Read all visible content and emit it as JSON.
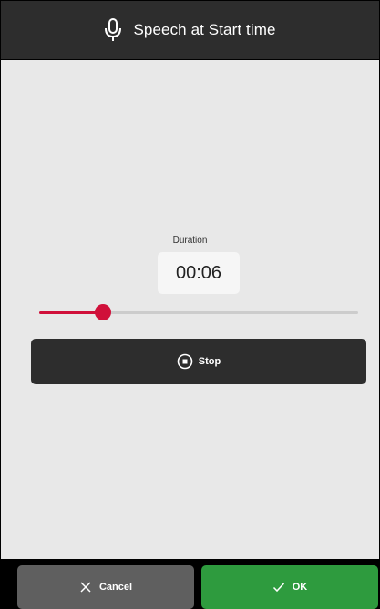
{
  "header": {
    "title": "Speech at Start time",
    "icon": "microphone-icon"
  },
  "duration": {
    "label": "Duration",
    "value": "00:06"
  },
  "slider": {
    "fraction": 0.2
  },
  "actions": {
    "stop_label": "Stop",
    "stop_icon": "stop-circle-icon",
    "cancel_label": "Cancel",
    "cancel_icon": "close-icon",
    "ok_label": "OK",
    "ok_icon": "checkmark-icon"
  },
  "colors": {
    "header_bg": "#2d2d2d",
    "content_bg": "#e8e8e8",
    "accent": "#d0103a",
    "ok_green": "#2e9b3e",
    "cancel_gray": "#5f5f5f"
  }
}
